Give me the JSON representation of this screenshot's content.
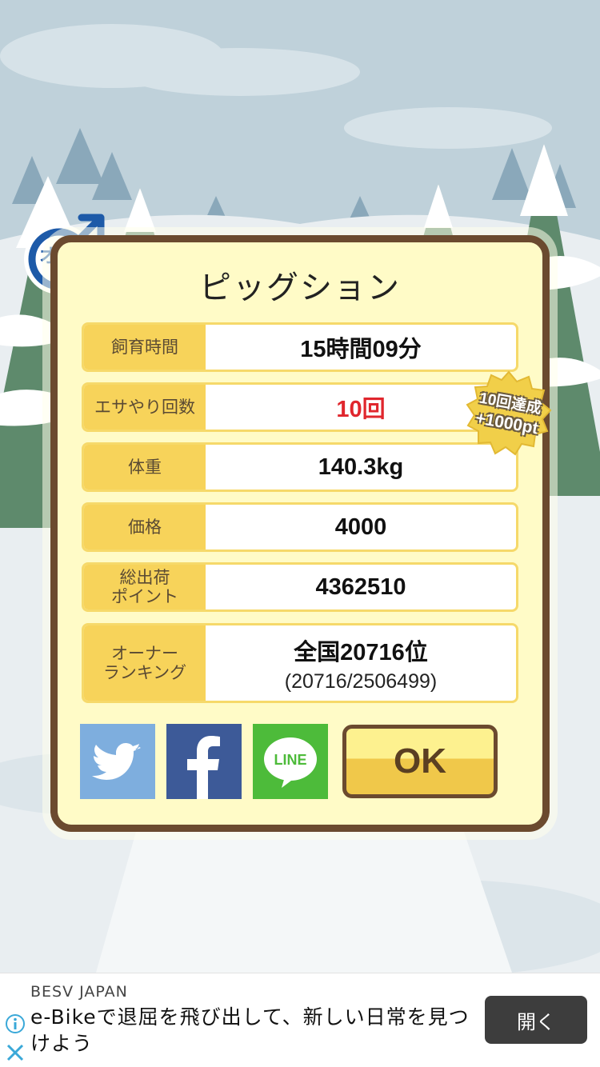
{
  "dialog": {
    "title": "ピッグション",
    "gender_label": "オス",
    "rows": [
      {
        "label": "飼育時間",
        "value": "15時間09分"
      },
      {
        "label": "エサやり回数",
        "value": "10回"
      },
      {
        "label": "体重",
        "value": "140.3kg"
      },
      {
        "label": "価格",
        "value": "4000"
      },
      {
        "label": "総出荷\nポイント",
        "value": "4362510"
      },
      {
        "label": "オーナー\nランキング",
        "value": "全国20716位",
        "sub": "(20716/2506499)"
      }
    ],
    "badge": {
      "line1": "10回達成",
      "line2": "+1000pt"
    },
    "ok_label": "OK",
    "line_label": "LINE"
  },
  "ad": {
    "sponsor": "BESV JAPAN",
    "text": "e-Bikeで退屈を飛び出して、新しい日常を見つけよう",
    "button": "開く"
  },
  "colors": {
    "frame": "#6b4a2f",
    "panel": "#fffbc7",
    "label_bg": "#f7d35a",
    "highlight_red": "#e0262d",
    "twitter": "#7eaede",
    "facebook": "#3d5a98",
    "line": "#4dbb3a"
  }
}
